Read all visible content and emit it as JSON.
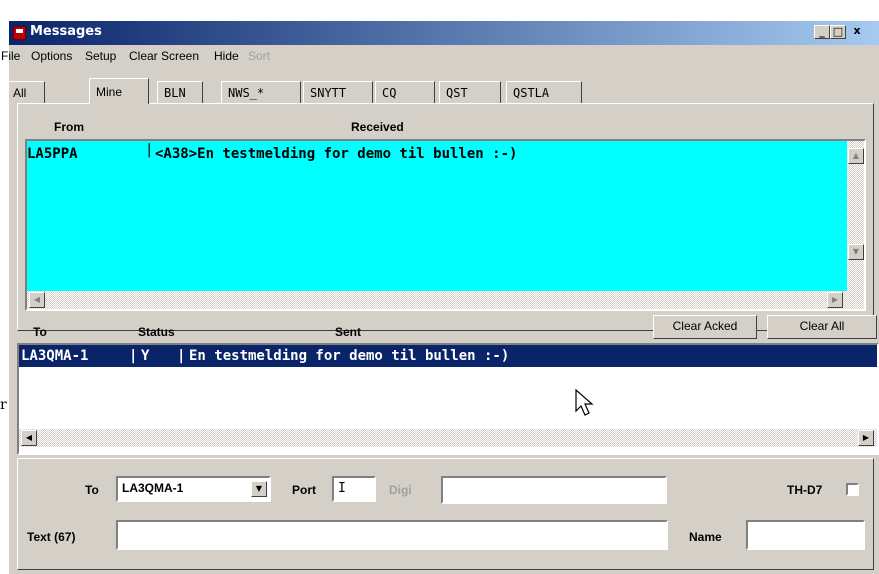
{
  "window": {
    "title": "Messages",
    "min": "_",
    "max": "□",
    "close": "x"
  },
  "menu": {
    "items": [
      {
        "label": "File",
        "disabled": false
      },
      {
        "label": "Options",
        "disabled": false
      },
      {
        "label": "Setup",
        "disabled": false
      },
      {
        "label": "Clear Screen",
        "disabled": false
      },
      {
        "label": "Hide",
        "disabled": false
      },
      {
        "label": "Sort",
        "disabled": true
      }
    ]
  },
  "tabs": [
    {
      "label": "All"
    },
    {
      "label": "Mine",
      "active": true
    },
    {
      "label": "BLN"
    },
    {
      "label": "NWS_*"
    },
    {
      "label": "SNYTT"
    },
    {
      "label": "CQ"
    },
    {
      "label": "QST"
    },
    {
      "label": "QSTLA"
    }
  ],
  "received": {
    "header_from": "From",
    "header_received": "Received",
    "rows": [
      {
        "from": "LA5PPA",
        "text": "<A38>En testmelding for demo til bullen :-)"
      }
    ],
    "bg_color": "#00ffff"
  },
  "sent": {
    "header_to": "To",
    "header_status": "Status",
    "header_sent": "Sent",
    "clear_acked": "Clear Acked",
    "clear_all": "Clear All",
    "rows": [
      {
        "to": "LA3QMA-1",
        "status": "Y",
        "text": "En testmelding for demo til bullen :-)"
      }
    ],
    "selected_color": "#0a246a"
  },
  "compose": {
    "to_label": "To",
    "to_value": "LA3QMA-1",
    "port_label": "Port",
    "port_value": "I",
    "digi_label": "Digi",
    "digi_value": "",
    "th_label": "TH-D7",
    "text_label": "Text (67)",
    "text_value": "",
    "name_label": "Name",
    "name_value": ""
  }
}
